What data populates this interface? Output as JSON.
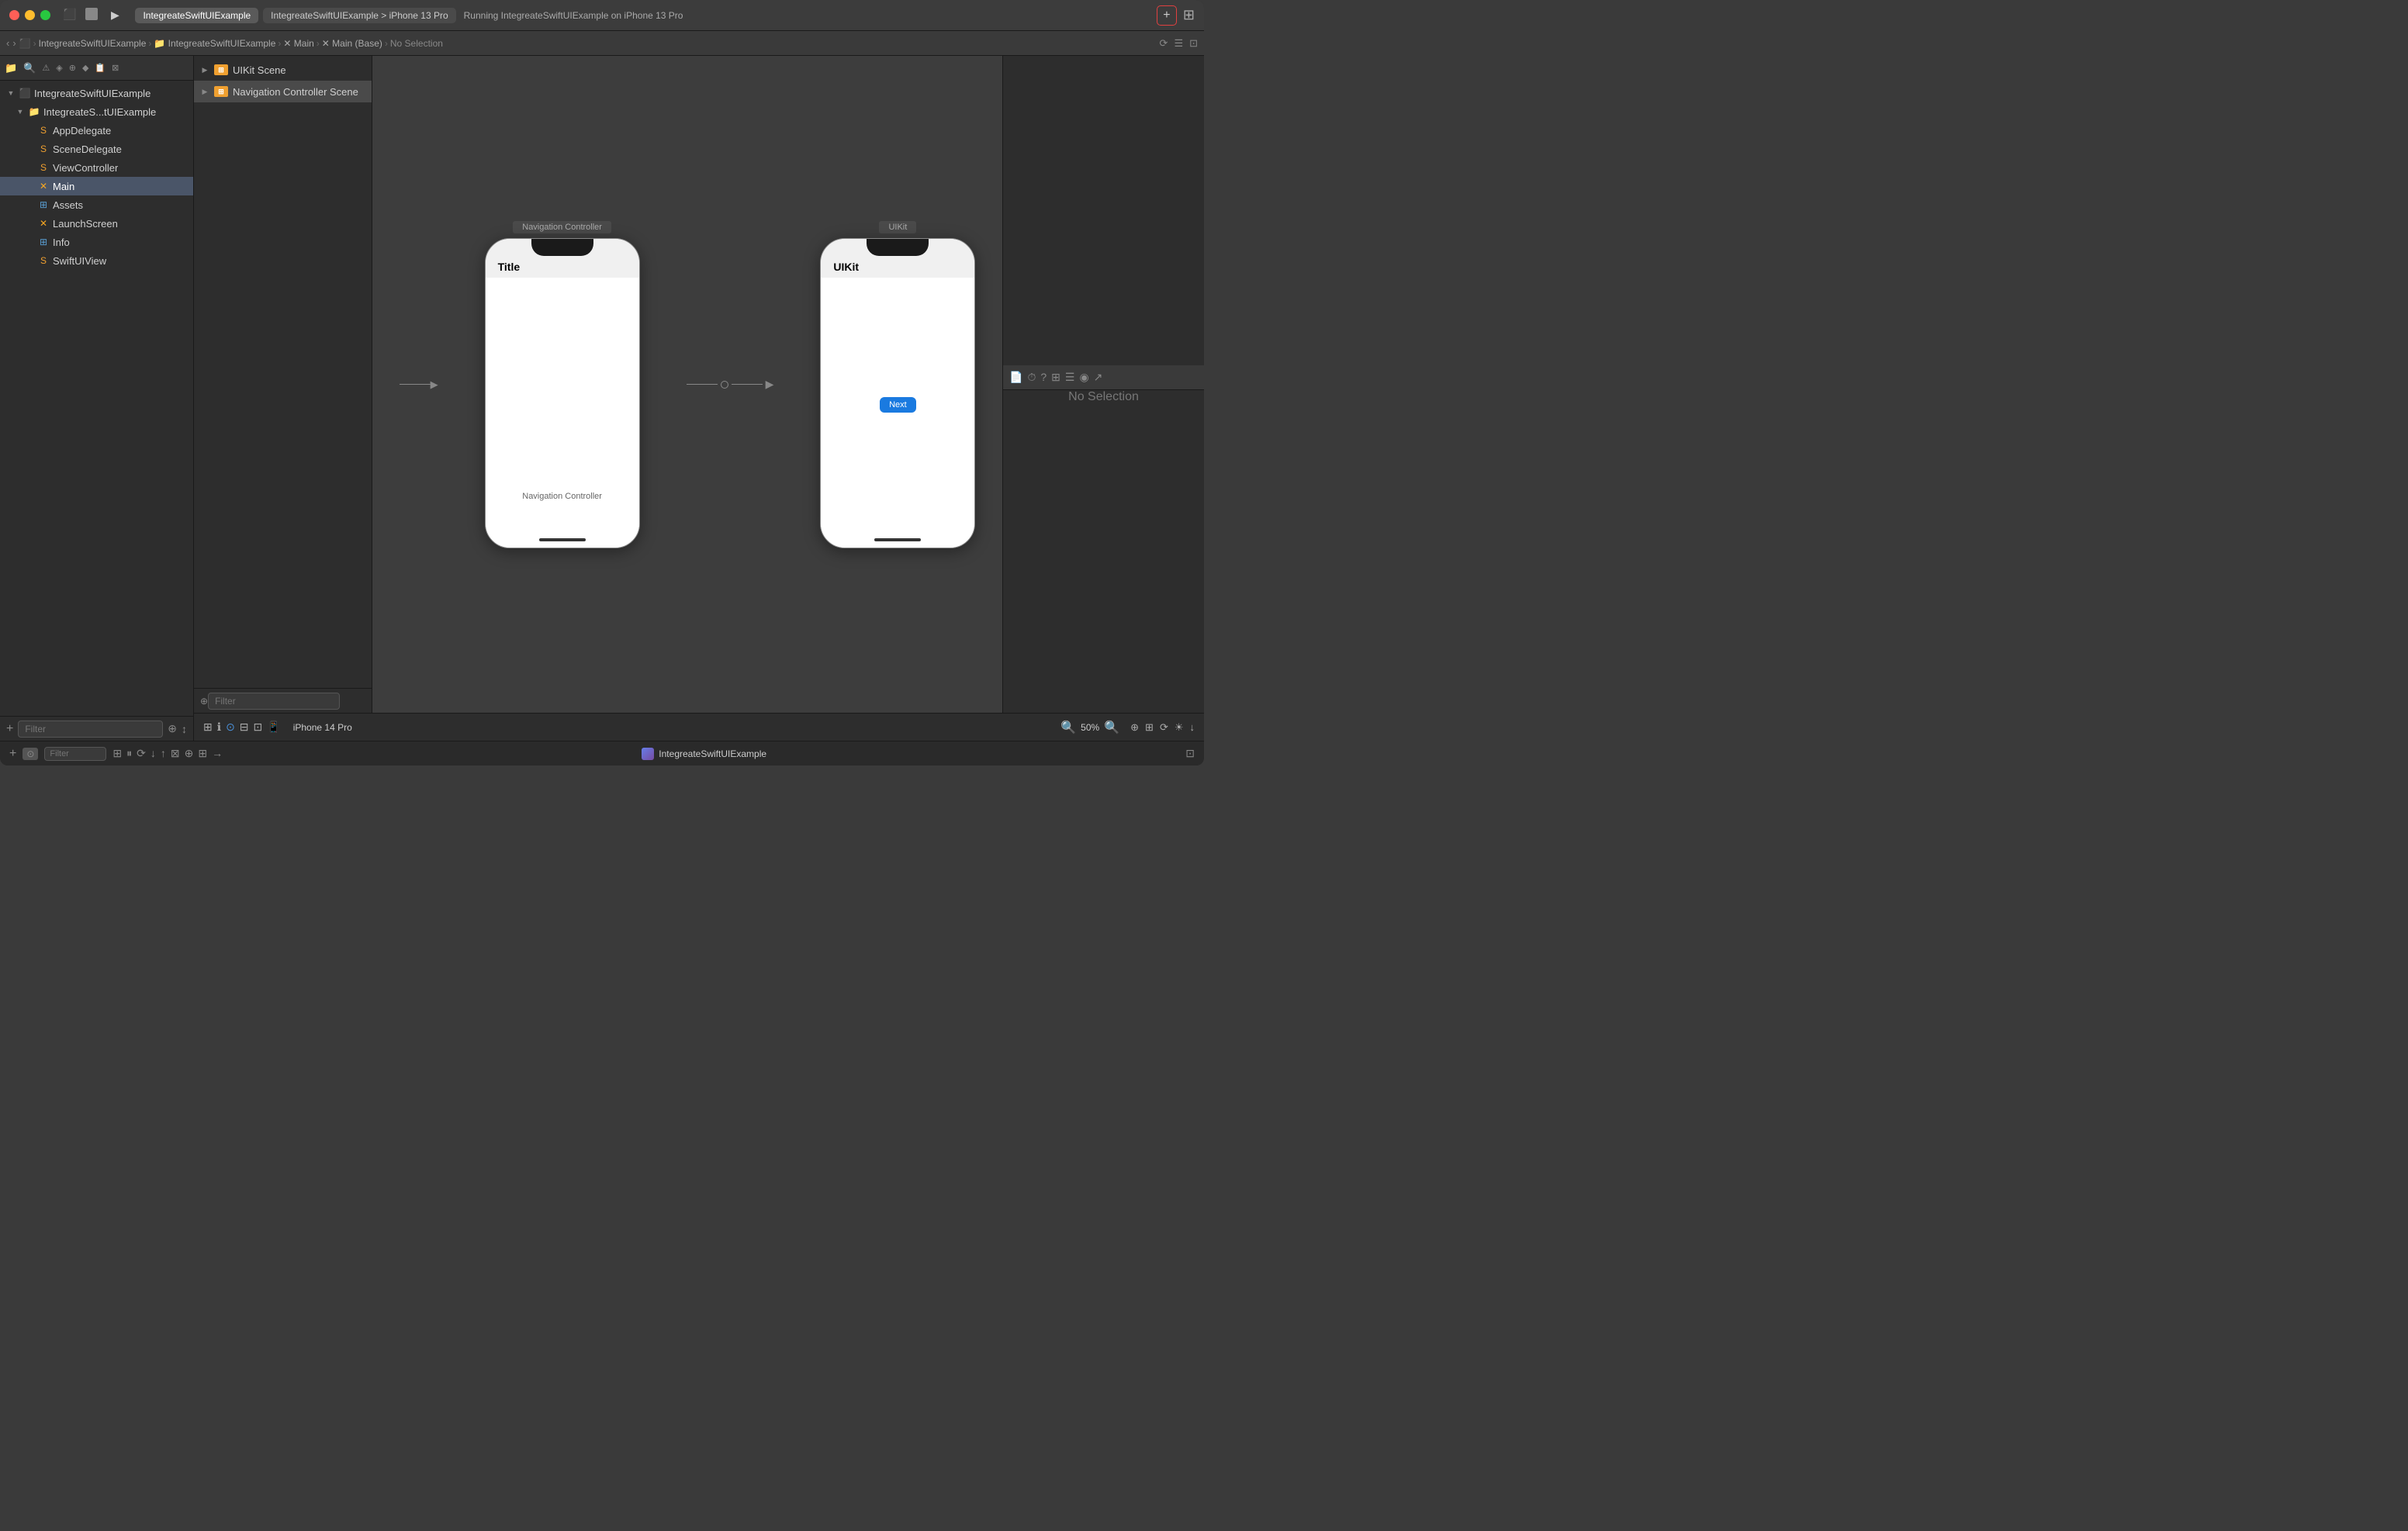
{
  "window": {
    "title": "IntegreateSwiftUIExample"
  },
  "titlebar": {
    "tabs": [
      {
        "label": "IntegreateSwiftUIExample",
        "active": true
      },
      {
        "label": "IntegreateSwiftUIExample > iPhone 13 Pro",
        "active": false
      }
    ],
    "run_info": "Running IntegreateSwiftUIExample on iPhone 13 Pro",
    "add_button_label": "+",
    "stop_icon": "■",
    "play_icon": "▶"
  },
  "breadcrumb": {
    "back": "‹",
    "forward": "›",
    "path": [
      "IntegreateSwiftUIExample",
      "IntegreateSwiftUIExample",
      "Main",
      "Main (Base)",
      "No Selection"
    ]
  },
  "sidebar": {
    "items": [
      {
        "label": "IntegreateSwiftUIExample",
        "level": 1,
        "type": "project",
        "arrow": "▼"
      },
      {
        "label": "IntegreateS...tUIExample",
        "level": 2,
        "type": "folder",
        "arrow": "▼"
      },
      {
        "label": "AppDelegate",
        "level": 3,
        "type": "swift"
      },
      {
        "label": "SceneDelegate",
        "level": 3,
        "type": "swift"
      },
      {
        "label": "ViewController",
        "level": 3,
        "type": "swift"
      },
      {
        "label": "Main",
        "level": 3,
        "type": "storyboard",
        "selected": true
      },
      {
        "label": "Assets",
        "level": 3,
        "type": "assets"
      },
      {
        "label": "LaunchScreen",
        "level": 3,
        "type": "storyboard-x"
      },
      {
        "label": "Info",
        "level": 3,
        "type": "grid"
      },
      {
        "label": "SwiftUIView",
        "level": 3,
        "type": "swift"
      }
    ],
    "filter_placeholder": "Filter"
  },
  "scene_outline": {
    "items": [
      {
        "label": "UIKit Scene",
        "arrow": "▶"
      },
      {
        "label": "Navigation Controller Scene",
        "arrow": "▶",
        "selected": true
      }
    ],
    "filter_placeholder": "Filter"
  },
  "canvas": {
    "scenes": [
      {
        "label": "Navigation Controller",
        "phone_title": "Title",
        "body_label": "Navigation Controller",
        "entry_arrow": true
      },
      {
        "label": "UIKit",
        "phone_title": "UIKit",
        "has_next_button": true,
        "next_button_label": "Next"
      }
    ],
    "no_selection": "No Selection",
    "device_label": "iPhone 14 Pro",
    "zoom_level": "50%"
  },
  "bottom_status": {
    "app_name": "IntegreateSwiftUIExample",
    "icons": [
      "⊞",
      "○",
      "⊟"
    ]
  }
}
